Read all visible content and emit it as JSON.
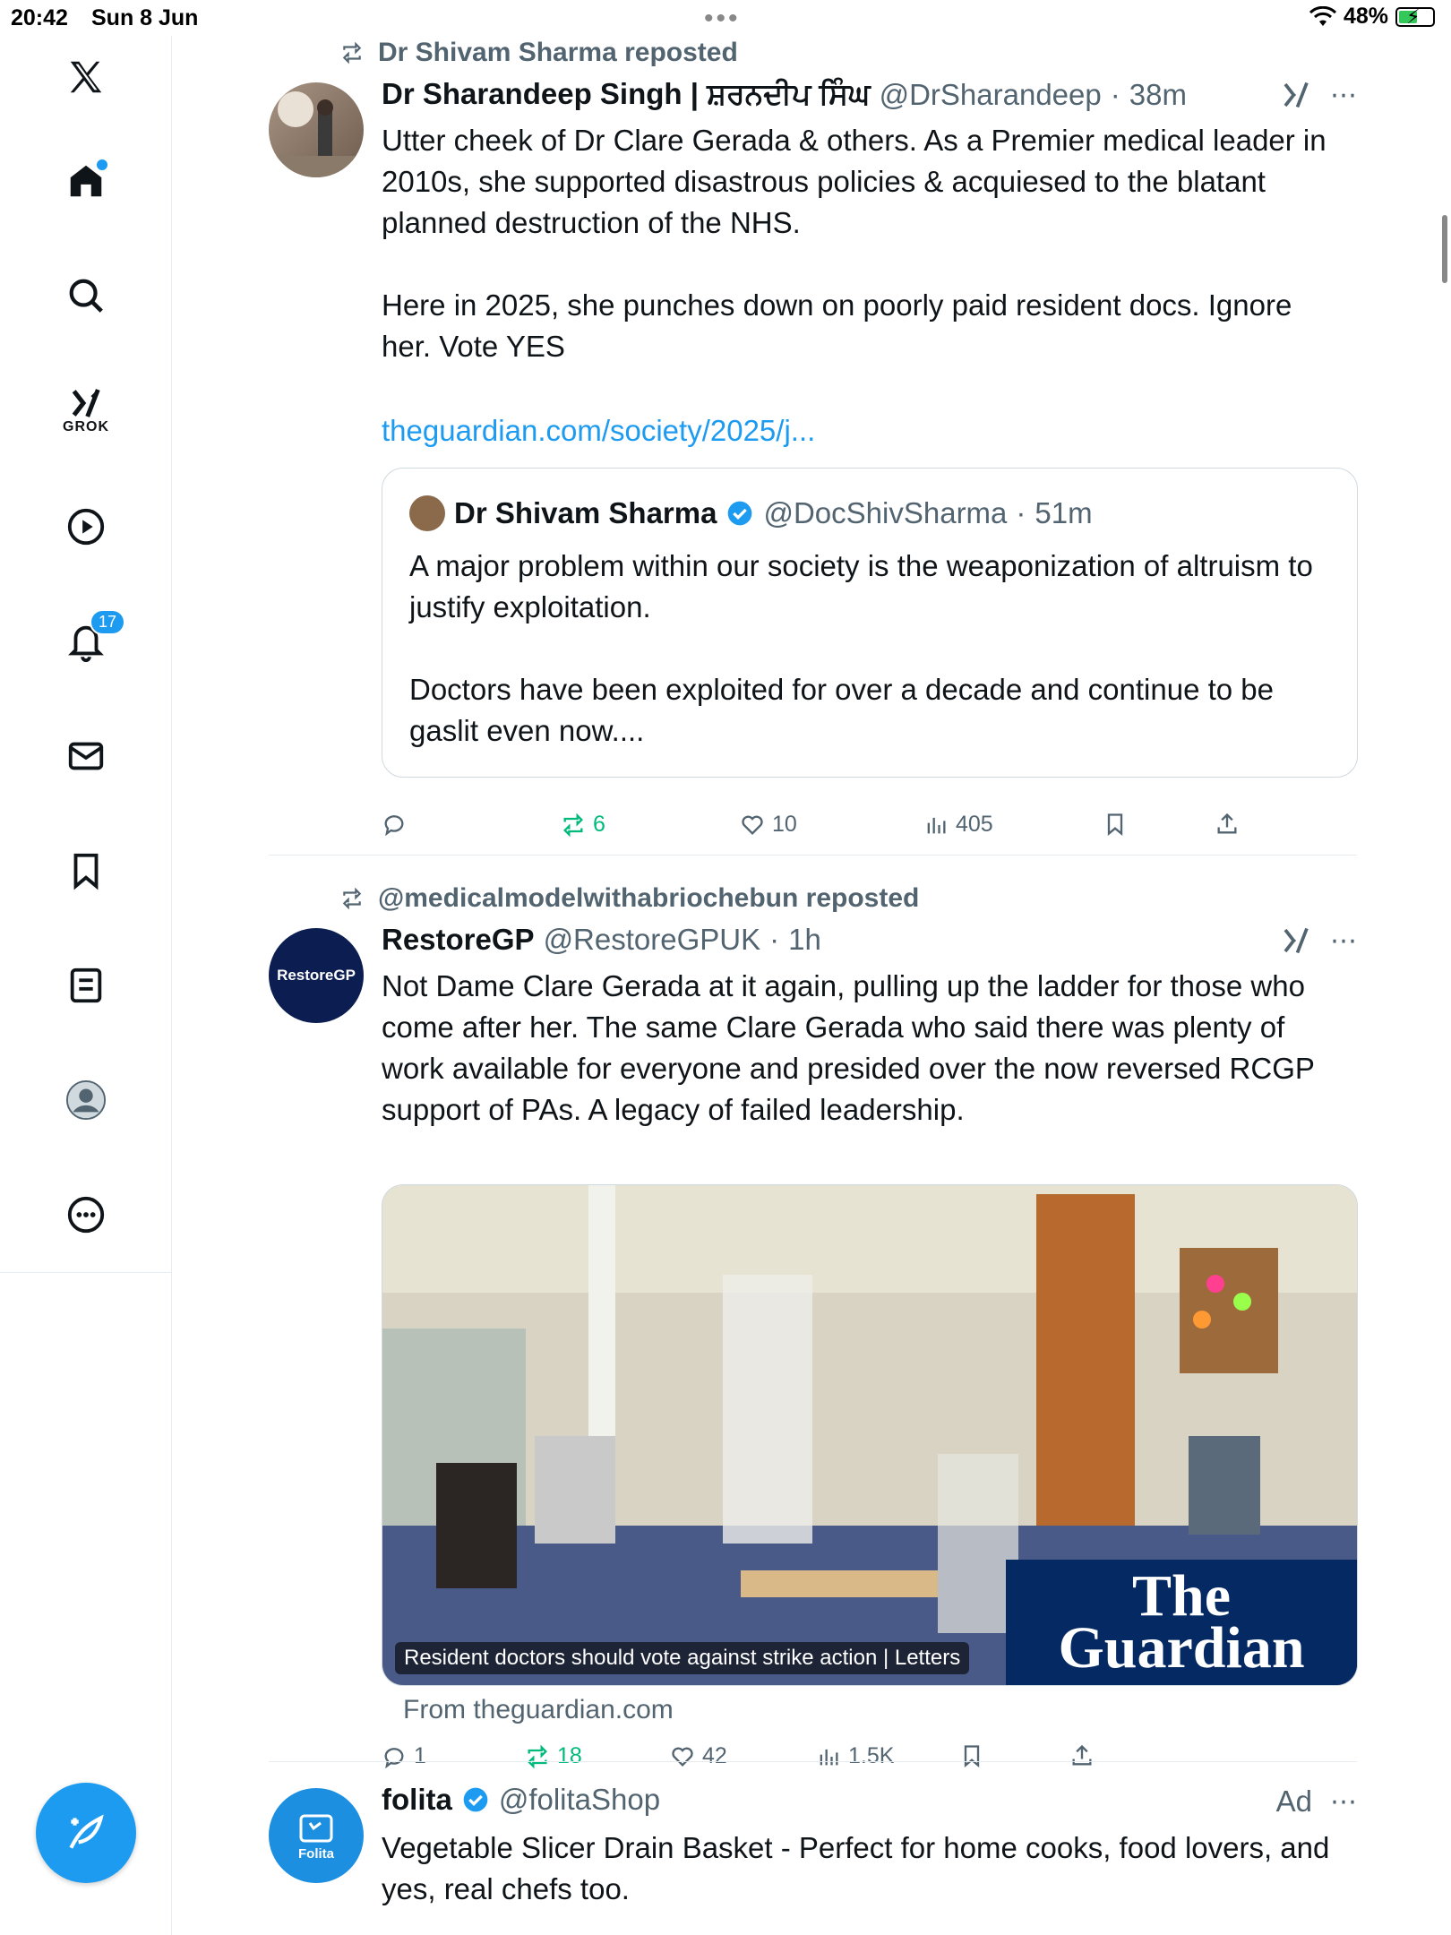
{
  "status_bar": {
    "time": "20:42",
    "date": "Sun 8 Jun",
    "battery": "48%"
  },
  "sidebar": {
    "grok_label": "GROK",
    "notifications_count": "17"
  },
  "posts": [
    {
      "repost_by": "Dr Shivam Sharma reposted",
      "name": "Dr Sharandeep Singh | ਸ਼ਰਨਦੀਪ ਸਿੰਘ",
      "handle": "@DrSharandeep",
      "time": "38m",
      "text": "Utter cheek of Dr Clare Gerada & others. As a Premier medical leader in 2010s, she supported disastrous policies & acquiesed to the blatant planned destruction of the NHS.\n\nHere in 2025, she punches down on poorly paid resident docs. Ignore her. Vote YES",
      "link": "theguardian.com/society/2025/j...",
      "quote": {
        "name": "Dr Shivam Sharma",
        "handle": "@DocShivSharma",
        "time": "51m",
        "text": "A major problem within our society is the weaponization of altruism to justify exploitation.\n\nDoctors have been exploited for over a decade and continue to be gaslit even now...."
      },
      "stats": {
        "replies": "",
        "reposts": "6",
        "likes": "10",
        "views": "405"
      }
    },
    {
      "repost_by": "@medicalmodelwithabriochebun reposted",
      "name": "RestoreGP",
      "handle": "@RestoreGPUK",
      "time": "1h",
      "avatar_text": "RestoreGP",
      "text": "Not Dame Clare Gerada at it again, pulling up the ladder for those who come after her. The same Clare Gerada who said there was plenty of work available for everyone and presided over the now reversed RCGP support of PAs. A legacy of failed leadership.",
      "media_caption": "Resident doctors should vote against strike action | Letters",
      "media_brand_line1": "The",
      "media_brand_line2": "Guardian",
      "from": "From theguardian.com",
      "stats": {
        "replies": "1",
        "reposts": "18",
        "likes": "42",
        "views": "1.5K"
      }
    },
    {
      "name": "folita",
      "handle": "@folitaShop",
      "ad_label": "Ad",
      "avatar_text": "Folita",
      "text": "Vegetable Slicer Drain Basket - Perfect for home cooks, food lovers, and yes, real chefs too."
    }
  ],
  "colors": {
    "accent": "#1d9bf0",
    "repost_green": "#00ba7c",
    "muted": "#536471",
    "guardian_blue": "#052962"
  }
}
